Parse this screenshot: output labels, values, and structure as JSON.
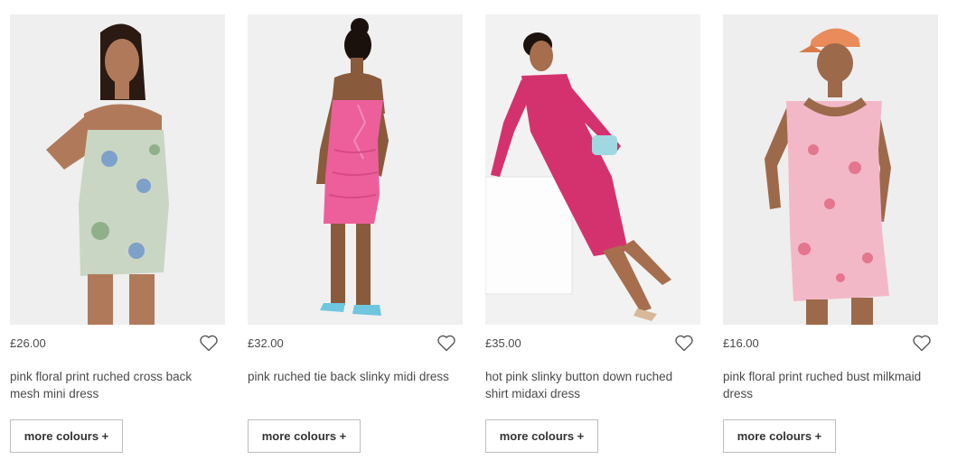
{
  "products": [
    {
      "price": "£26.00",
      "title": "pink floral print ruched cross back mesh mini dress",
      "more_label": "more colours +",
      "dress_color": "#c9d6c3",
      "accent_color": "#7ea1c9",
      "skin_color": "#b07a5a",
      "hair_color": "#2a1a12"
    },
    {
      "price": "£32.00",
      "title": "pink ruched tie back slinky midi dress",
      "more_label": "more colours +",
      "dress_color": "#ec5f9a",
      "accent_color": "#f28cb8",
      "skin_color": "#8a5a3c",
      "hair_color": "#1a100c"
    },
    {
      "price": "£35.00",
      "title": "hot pink slinky button down ruched shirt midaxi dress",
      "more_label": "more colours +",
      "dress_color": "#d4326e",
      "accent_color": "#9fd8e0",
      "skin_color": "#a66e4d",
      "hair_color": "#1c120e"
    },
    {
      "price": "£16.00",
      "title": "pink floral print ruched bust milkmaid dress",
      "more_label": "more colours +",
      "dress_color": "#f3b8c8",
      "accent_color": "#e4768f",
      "skin_color": "#9c6a4b",
      "hair_color": "#e98b5a"
    }
  ]
}
